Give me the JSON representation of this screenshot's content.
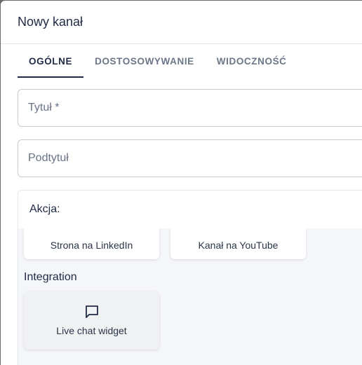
{
  "dialog": {
    "title": "Nowy kanał"
  },
  "tabs": [
    {
      "label": "OGÓLNE",
      "active": true
    },
    {
      "label": "DOSTOSOWYWANIE",
      "active": false
    },
    {
      "label": "WIDOCZNOŚĆ",
      "active": false
    }
  ],
  "form": {
    "title_placeholder": "Tytuł *",
    "title_value": "",
    "subtitle_placeholder": "Podtytuł",
    "subtitle_value": ""
  },
  "action": {
    "label": "Akcja:",
    "options": [
      {
        "label": "Strona na LinkedIn"
      },
      {
        "label": "Kanał na YouTube"
      }
    ],
    "integration_title": "Integration",
    "integration_options": [
      {
        "label": "Live chat widget",
        "icon": "chat-bubble-icon"
      }
    ]
  },
  "colors": {
    "primary_text": "#1f2a44",
    "muted_text": "#6b7687",
    "panel_bg": "#f5f6fa"
  }
}
